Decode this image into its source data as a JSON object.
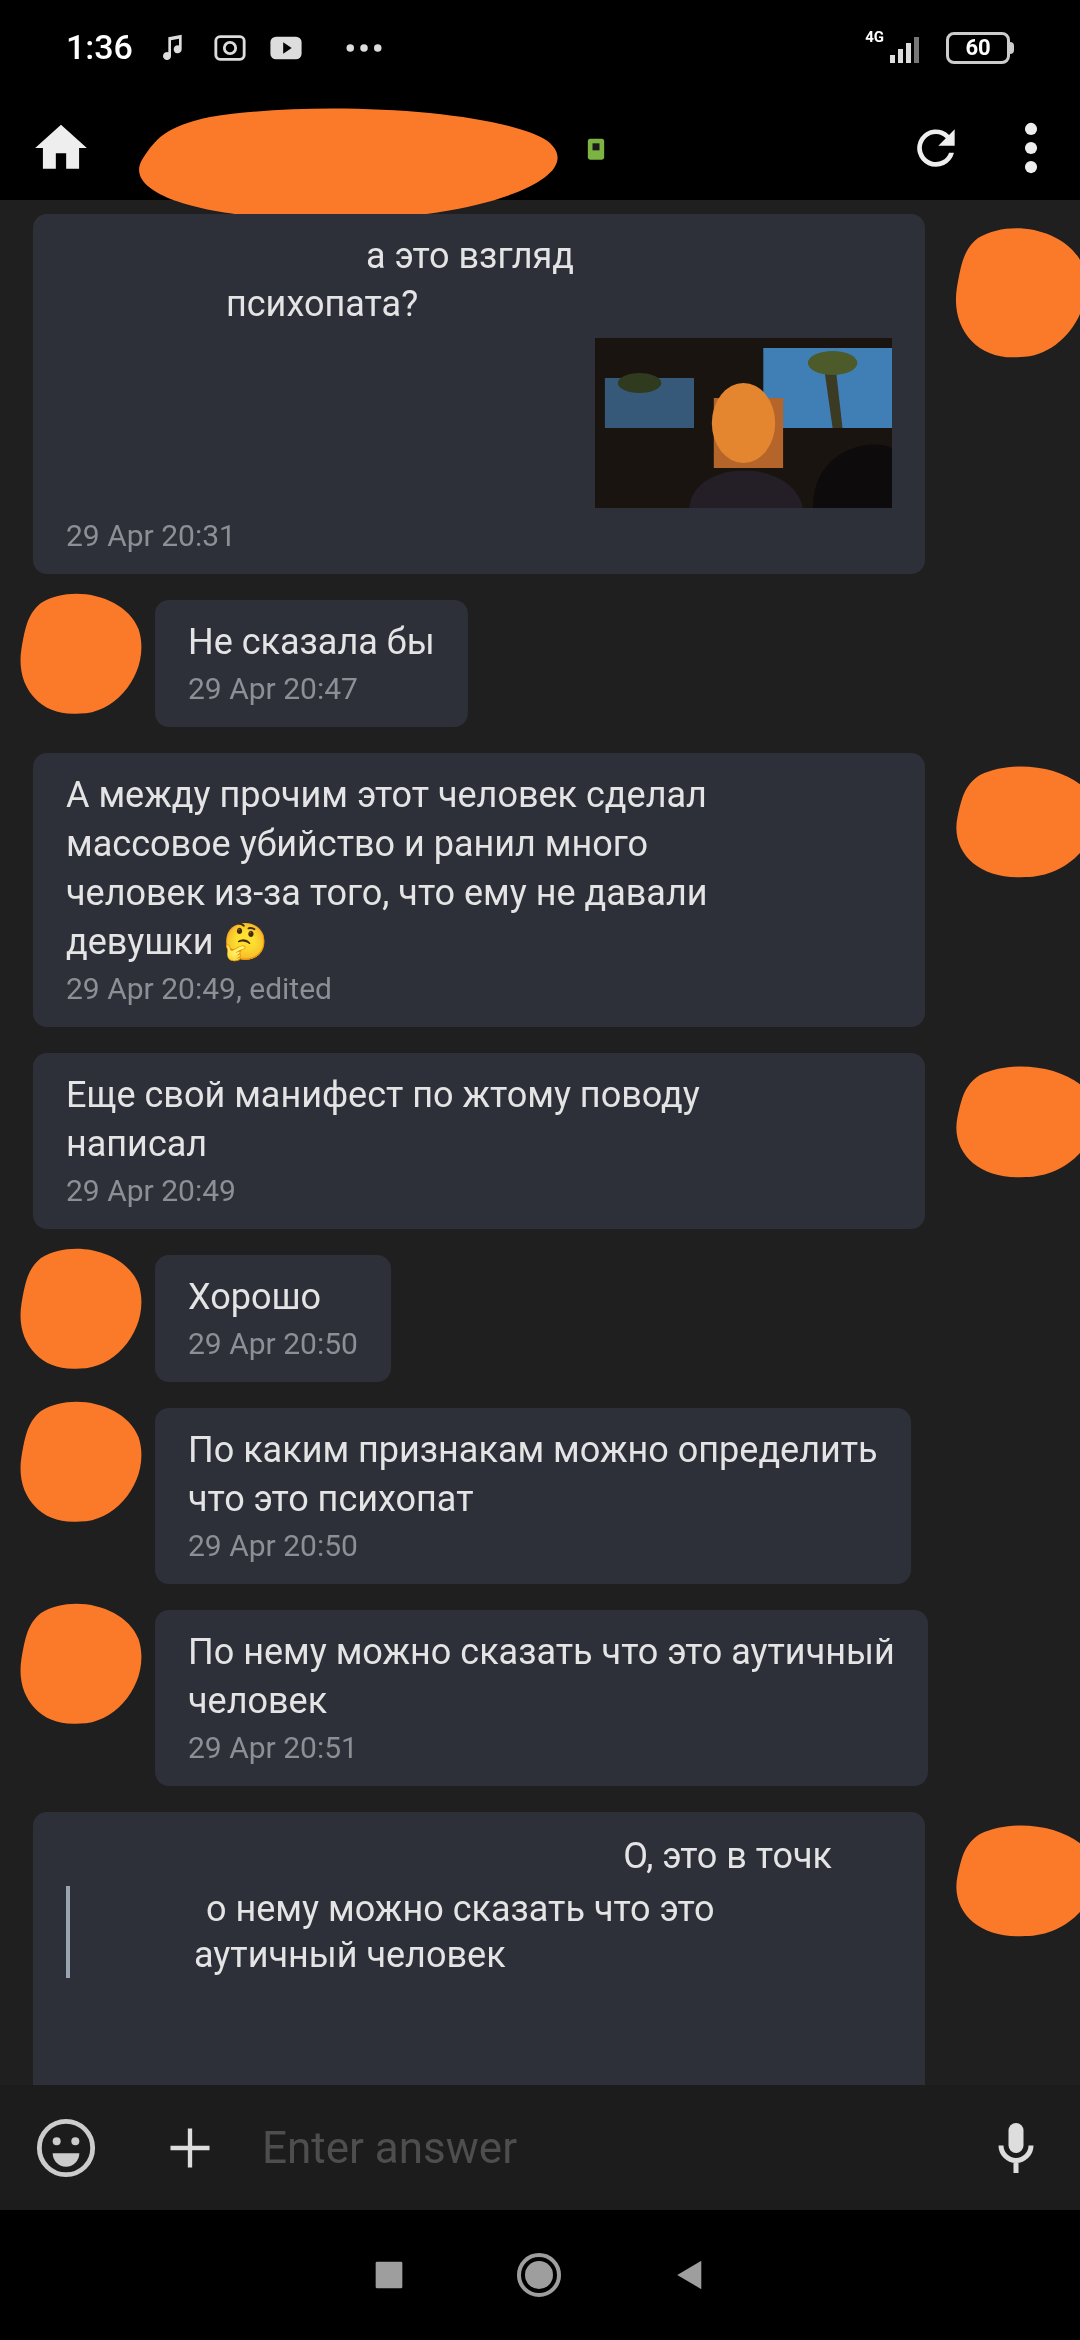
{
  "status_bar": {
    "time": "1:36",
    "network": "4G",
    "battery": "60"
  },
  "input": {
    "placeholder": "Enter answer"
  },
  "messages": [
    {
      "outgoing": true,
      "lines": [
        "а это взгляд",
        "психопата?"
      ],
      "time": "29 Apr 20:31"
    },
    {
      "outgoing": false,
      "kind": "text",
      "lines": [
        "Не сказала бы"
      ],
      "time": "29 Apr 20:47"
    },
    {
      "outgoing": true,
      "kind": "text",
      "lines": [
        "А между прочим этот человек сделал",
        "массовое убийство и ранил много",
        "человек из-за того, что ему не давали",
        "девушки 🤔"
      ],
      "time": "29 Apr 20:49, edited"
    },
    {
      "outgoing": true,
      "kind": "text",
      "lines": [
        "Еще свой манифест по жтому поводу",
        "написал"
      ],
      "time": "29 Apr 20:49"
    },
    {
      "outgoing": false,
      "kind": "text",
      "lines": [
        "Хорошо"
      ],
      "time": "29 Apr 20:50"
    },
    {
      "outgoing": false,
      "kind": "text",
      "lines": [
        "По каким признакам можно определить",
        "что это психопат"
      ],
      "time": "29 Apr 20:50"
    },
    {
      "outgoing": false,
      "kind": "text",
      "lines": [
        "По нему можно сказать что это аутичный",
        "человек"
      ],
      "time": "29 Apr 20:51"
    },
    {
      "outgoing": true,
      "kind": "quote",
      "lines": [
        "О, это в точк"
      ],
      "quote": [
        "о нему можно сказать что это",
        "аутичный человек"
      ]
    }
  ]
}
